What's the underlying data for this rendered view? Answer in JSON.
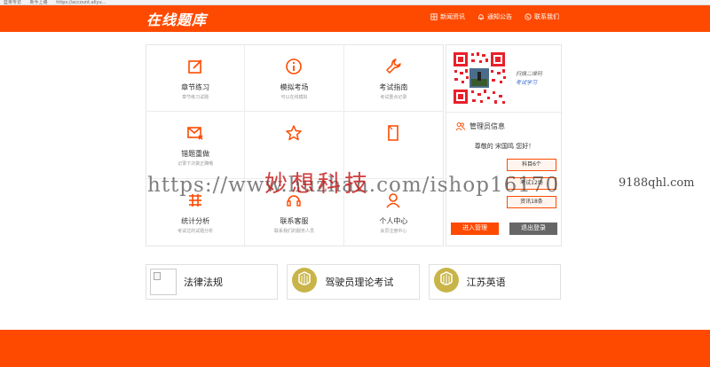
{
  "browser": {
    "bookmark1": "篮果专访",
    "bookmark2": "新手上路",
    "url": "https://account.aliyu..."
  },
  "header": {
    "logo": "在线题库",
    "nav": [
      {
        "label": "新闻资讯",
        "icon": "grid-icon"
      },
      {
        "label": "通知公告",
        "icon": "bell-icon"
      },
      {
        "label": "联系我们",
        "icon": "phone-icon"
      }
    ]
  },
  "tiles": [
    {
      "title": "章节练习",
      "subtitle": "章节练习试题",
      "icon": "edit-icon"
    },
    {
      "title": "模拟考场",
      "subtitle": "可以在线模拟",
      "icon": "info-icon"
    },
    {
      "title": "考试指南",
      "subtitle": "考试重点记录",
      "icon": "wrench-icon"
    },
    {
      "title": "错题重做",
      "subtitle": "记录下次做正确哦",
      "icon": "mail-x-icon"
    },
    {
      "title": "",
      "subtitle": "",
      "icon": "star-icon"
    },
    {
      "title": "",
      "subtitle": "",
      "icon": "document-icon"
    },
    {
      "title": "统计分析",
      "subtitle": "考试过的试题分析",
      "icon": "stats-icon"
    },
    {
      "title": "联系客服",
      "subtitle": "联系我们的服务人员",
      "icon": "service-icon"
    },
    {
      "title": "个人中心",
      "subtitle": "会员注册中心",
      "icon": "user-icon"
    }
  ],
  "side": {
    "qr_caption_line1": "扫描二维码",
    "qr_caption_line2": "考试学习",
    "admin_title": "管理员信息",
    "greeting": "尊敬的 宋国鸣 您好！",
    "stats": [
      "科目6个",
      "考试12场",
      "资讯18条"
    ],
    "enter_label": "进入管理",
    "logout_label": "退出登录"
  },
  "categories": [
    {
      "label": "法律法规",
      "icon": "broken-image-icon"
    },
    {
      "label": "驾驶员理论考试",
      "icon": "emblem-icon"
    },
    {
      "label": "江苏英语",
      "icon": "emblem-icon"
    }
  ],
  "watermark": {
    "url_text": "https://www.huzhan.com/ishop16170",
    "cn_text": "妙想科技",
    "side_text": "9188qhl.com"
  },
  "colors": {
    "accent": "#fe4a00",
    "gold": "#c8b449"
  }
}
